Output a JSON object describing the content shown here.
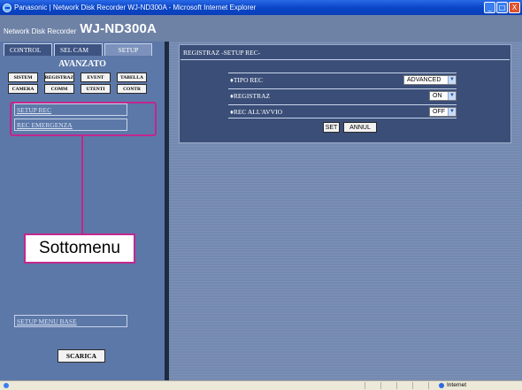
{
  "window": {
    "title": "Panasonic | Network Disk Recorder WJ-ND300A - Microsoft Internet Explorer",
    "controls": [
      "_",
      "□",
      "X"
    ]
  },
  "app": {
    "subtitle": "Network Disk Recorder",
    "model": "WJ-ND300A"
  },
  "tabs": [
    {
      "label": "CONTROL"
    },
    {
      "label": "SEL CAM"
    },
    {
      "label": "SETUP"
    }
  ],
  "panel": {
    "section_title": "AVANZATO",
    "buttons_row1": [
      "SISTEM",
      "REGISTRAZ",
      "EVENT",
      "TABELLA"
    ],
    "buttons_row2": [
      "CAMERA",
      "COMM",
      "UTENTI",
      "CONTR"
    ],
    "submenu": [
      "SETUP REC",
      "REC EMERGENZA"
    ],
    "base_menu_link": "SETUP MENU BASE",
    "download_button": "SCARICA"
  },
  "annotation": {
    "label": "Sottomenu",
    "color": "#c2278e"
  },
  "settings": {
    "heading": "REGISTRAZ -SETUP REC-",
    "rows": [
      {
        "label": "♦TIPO REC",
        "value": "ADVANCED"
      },
      {
        "label": "♦REGISTRAZ",
        "value": "ON"
      },
      {
        "label": "♦REC ALL'AVVIO",
        "value": "OFF"
      }
    ],
    "set_button": "SET",
    "cancel_button": "ANNUL"
  },
  "statusbar": {
    "zone": "Internet"
  }
}
